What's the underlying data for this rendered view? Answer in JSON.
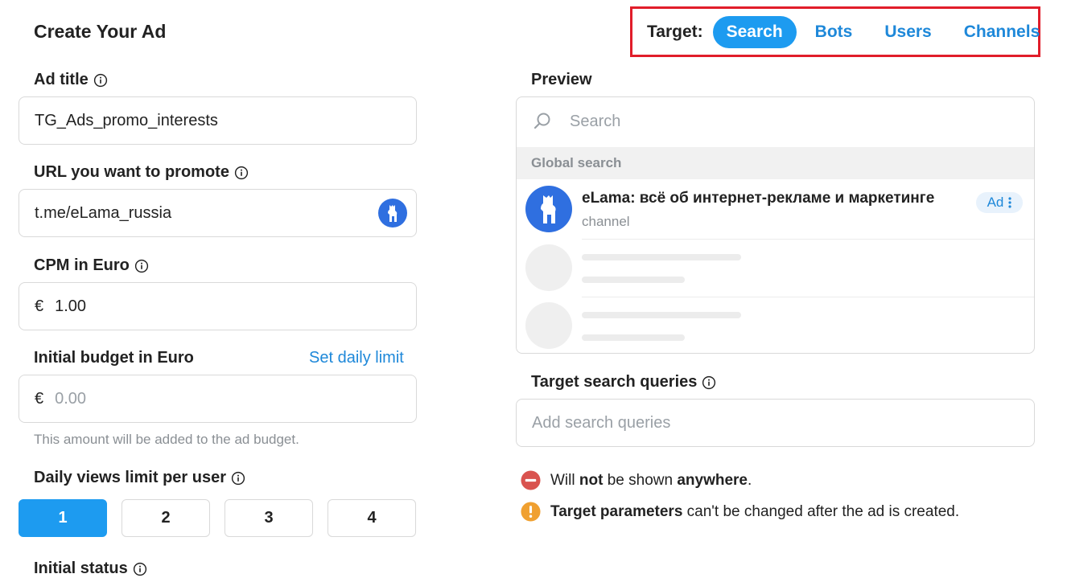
{
  "page": {
    "title": "Create Your Ad"
  },
  "target": {
    "label": "Target:",
    "tabs": [
      {
        "label": "Search",
        "active": true
      },
      {
        "label": "Bots",
        "active": false
      },
      {
        "label": "Users",
        "active": false
      },
      {
        "label": "Channels",
        "active": false
      }
    ]
  },
  "form": {
    "ad_title": {
      "label": "Ad title",
      "value": "TG_Ads_promo_interests"
    },
    "url": {
      "label": "URL you want to promote",
      "value": "t.me/eLama_russia"
    },
    "cpm": {
      "label": "CPM in Euro",
      "currency": "€",
      "value": "1.00"
    },
    "budget": {
      "label": "Initial budget in Euro",
      "link": "Set daily limit",
      "currency": "€",
      "placeholder": "0.00",
      "hint": "This amount will be added to the ad budget."
    },
    "daily_views": {
      "label": "Daily views limit per user",
      "options": [
        "1",
        "2",
        "3",
        "4"
      ],
      "selected": "1"
    },
    "initial_status": {
      "label": "Initial status"
    }
  },
  "preview": {
    "label": "Preview",
    "search_placeholder": "Search",
    "section_header": "Global search",
    "result": {
      "name": "eLama: всё об интернет-рекламе и маркетинге",
      "subtitle": "channel",
      "badge": "Ad"
    }
  },
  "queries": {
    "label": "Target search queries",
    "placeholder": "Add search queries"
  },
  "notices": {
    "n1": {
      "pre": "Will ",
      "b1": "not",
      "mid": " be shown ",
      "b2": "anywhere",
      "post": "."
    },
    "n2": {
      "b1": "Target parameters",
      "post": " can't be changed after the ad is created."
    }
  },
  "colors": {
    "accent": "#1d9bf0",
    "highlight_border": "#e11d2a",
    "error": "#d9534f",
    "warning": "#f0a030"
  }
}
